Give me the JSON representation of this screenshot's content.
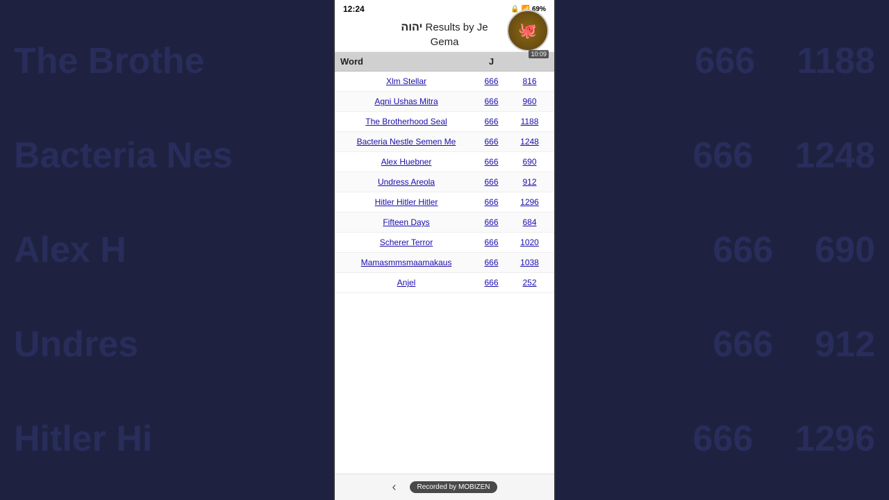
{
  "background": {
    "left_texts": [
      "The Brothe",
      "Bacteria Nes",
      "Alex H",
      "Undres",
      "Hitler Hi"
    ],
    "right_texts": [
      "666",
      "1188",
      "666",
      "1248",
      "666",
      "690",
      "666",
      "912",
      "666",
      "1296"
    ]
  },
  "status_bar": {
    "time": "12:24",
    "battery": "69%",
    "icons": "🔒 ✉ ≡ |•"
  },
  "header": {
    "hebrew": "יהוה",
    "title": "Results by Je",
    "subtitle": "Gema"
  },
  "avatar": {
    "time_label": "10:09"
  },
  "table": {
    "columns": [
      "Word",
      "J",
      ""
    ],
    "rows": [
      {
        "word": "Xlm Stellar",
        "col2": "666",
        "col3": "816"
      },
      {
        "word": "Agni Ushas Mitra",
        "col2": "666",
        "col3": "960"
      },
      {
        "word": "The Brotherhood Seal",
        "col2": "666",
        "col3": "1188"
      },
      {
        "word": "Bacteria Nestle Semen Me",
        "col2": "666",
        "col3": "1248"
      },
      {
        "word": "Alex Huebner",
        "col2": "666",
        "col3": "690"
      },
      {
        "word": "Undress Areola",
        "col2": "666",
        "col3": "912"
      },
      {
        "word": "Hitler Hitler Hitler",
        "col2": "666",
        "col3": "1296"
      },
      {
        "word": "Fifteen Days",
        "col2": "666",
        "col3": "684"
      },
      {
        "word": "Scherer Terror",
        "col2": "666",
        "col3": "1020"
      },
      {
        "word": "Mamasmmsmaamakaus",
        "col2": "666",
        "col3": "1038"
      },
      {
        "word": "Anjel",
        "col2": "666",
        "col3": "252"
      }
    ]
  },
  "bottom": {
    "arrow": "‹",
    "recorded_label": "Recorded by"
  }
}
